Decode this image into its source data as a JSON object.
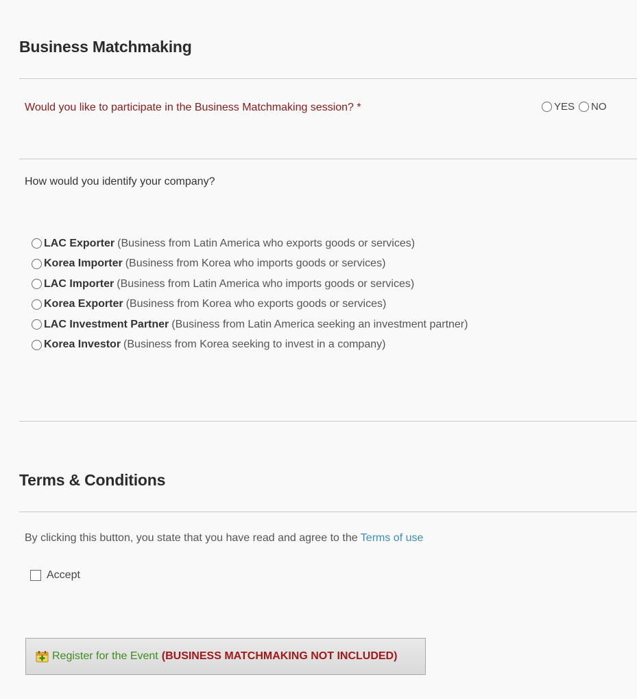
{
  "matchmaking": {
    "title": "Business Matchmaking",
    "question": "Would you like to participate in the Business Matchmaking session? *",
    "yes_label": "YES",
    "no_label": "NO",
    "identify_question": "How would you identify your company?",
    "options": [
      {
        "title": "LAC Exporter",
        "desc": "(Business from Latin America who exports goods or services)"
      },
      {
        "title": "Korea Importer",
        "desc": "(Business from Korea who imports goods or services)"
      },
      {
        "title": "LAC Importer",
        "desc": "(Business from Latin America who imports goods or services)"
      },
      {
        "title": "Korea Exporter",
        "desc": "(Business from Korea who exports goods or services)"
      },
      {
        "title": "LAC Investment Partner",
        "desc": "(Business from Latin America seeking an investment partner)"
      },
      {
        "title": "Korea Investor",
        "desc": "(Business from Korea seeking to invest in a company)"
      }
    ]
  },
  "terms": {
    "title": "Terms & Conditions",
    "statement": "By clicking this button, you state that you have read and agree to the",
    "link": "Terms of use",
    "accept_label": "Accept"
  },
  "register": {
    "main_label": "Register for the Event",
    "note": "(BUSINESS MATCHMAKING NOT INCLUDED)",
    "icon": "register-calendar-icon"
  },
  "colors": {
    "required_text": "#8b1a1a",
    "link": "#3a8fb7",
    "register_green": "#3e8b1e",
    "register_red": "#a01818"
  }
}
